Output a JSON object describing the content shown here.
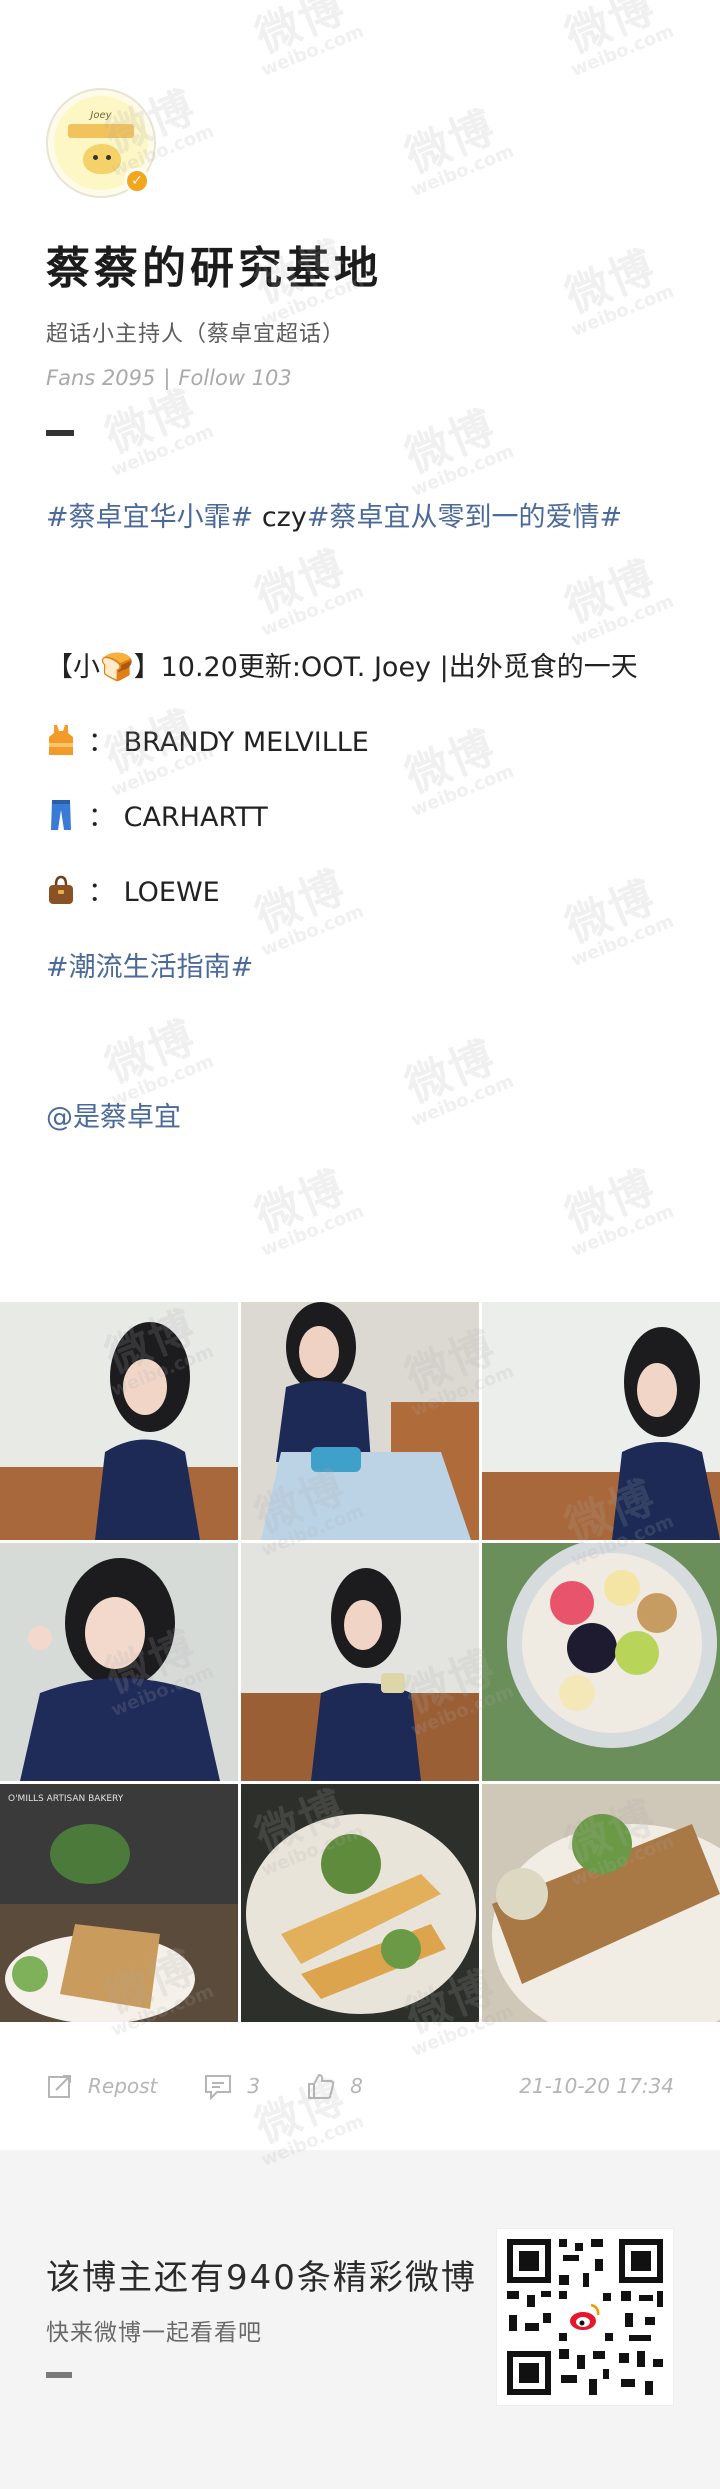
{
  "profile": {
    "name": "蔡蔡的研究基地",
    "description": "超话小主持人（蔡卓宜超话）",
    "fans_label": "Fans 2095",
    "follow_label": "Follow 103",
    "stats_separator": "|"
  },
  "post": {
    "topic1": "#蔡卓宜华小霏#",
    "czy": " czy",
    "topic2": "#蔡卓宜从零到一的爱情#",
    "update_line": "【小🍞】10.20更新:OOT. Joey |出外觅食的一天",
    "outfits": [
      {
        "icon": "tank-top-icon",
        "brand": "BRANDY MELVILLE"
      },
      {
        "icon": "jeans-icon",
        "brand": "CARHARTT"
      },
      {
        "icon": "handbag-icon",
        "brand": "LOEWE"
      }
    ],
    "outfit_separator": "：",
    "topic3": "#潮流生活指南#",
    "mention": "@是蔡卓宜"
  },
  "photos": {
    "count": 9,
    "bakery_caption": "O'MILLS ARTISAN BAKERY"
  },
  "actions": {
    "repost_label": "Repost",
    "comment_count": "3",
    "like_count": "8",
    "timestamp": "21-10-20 17:34"
  },
  "footer": {
    "main_text": "该博主还有940条精彩微博",
    "sub_text": "快来微博一起看看吧"
  },
  "watermark": {
    "text": "微博",
    "sub": "weibo.com"
  },
  "colors": {
    "link": "#4b6a99",
    "verified_badge": "#f3a51b",
    "footer_bg": "#f4f4f4"
  }
}
